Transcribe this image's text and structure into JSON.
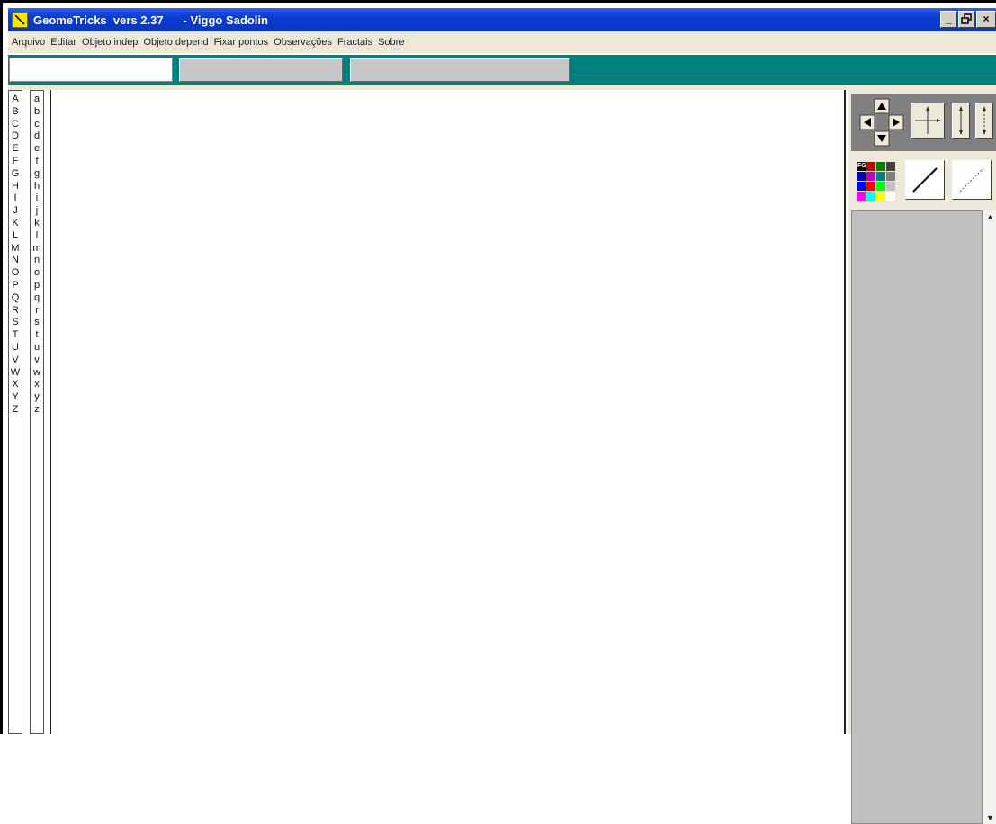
{
  "window": {
    "title": "GeomeTricks  vers 2.37",
    "author": "- Viggo Sadolin",
    "controls": [
      "minimize-icon",
      "restore-icon",
      "close-icon"
    ]
  },
  "menubar": {
    "items": [
      "Arquivo",
      "Editar",
      "Objeto indep",
      "Objeto depend",
      "Fixar pontos",
      "Observações",
      "Fractais",
      "Sobre"
    ]
  },
  "toolbar": {
    "input_value": ""
  },
  "letters": {
    "upper": [
      "A",
      "B",
      "C",
      "D",
      "E",
      "F",
      "G",
      "H",
      "I",
      "J",
      "K",
      "L",
      "M",
      "N",
      "O",
      "P",
      "Q",
      "R",
      "S",
      "T",
      "U",
      "V",
      "W",
      "X",
      "Y",
      "Z"
    ],
    "lower": [
      "a",
      "b",
      "c",
      "d",
      "e",
      "f",
      "g",
      "h",
      "i",
      "j",
      "k",
      "l",
      "m",
      "n",
      "o",
      "p",
      "q",
      "r",
      "s",
      "t",
      "u",
      "v",
      "w",
      "x",
      "y",
      "z"
    ]
  },
  "right_panel": {
    "palette_label": "FG",
    "icons": [
      "arrow-pad-icon",
      "crosshair-icon",
      "vertical-measure-icon",
      "vertical-dotted-measure-icon",
      "color-palette-icon",
      "solid-line-icon",
      "dotted-line-icon"
    ]
  },
  "colors": {
    "titlebar": "#0a3ad0",
    "toolbar": "#00807c",
    "menubar": "#ece9d8",
    "list_bg": "#c0c0c0"
  }
}
